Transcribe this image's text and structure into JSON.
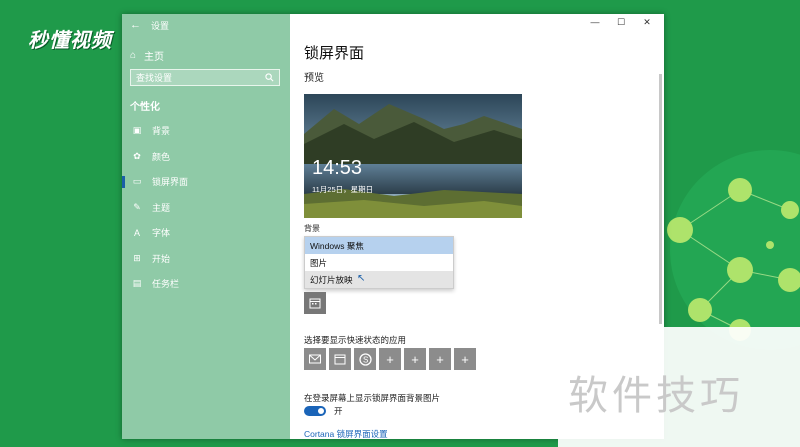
{
  "watermark_logo": "秒懂视频",
  "window": {
    "title": "设置",
    "controls": {
      "minimize": "—",
      "maximize": "☐",
      "close": "✕"
    }
  },
  "sidebar": {
    "home_label": "主页",
    "search_placeholder": "查找设置",
    "section_title": "个性化",
    "items": [
      {
        "label": "背景",
        "icon": "image-icon"
      },
      {
        "label": "颜色",
        "icon": "palette-icon"
      },
      {
        "label": "锁屏界面",
        "icon": "monitor-icon",
        "active": true
      },
      {
        "label": "主题",
        "icon": "brush-icon"
      },
      {
        "label": "字体",
        "icon": "font-icon"
      },
      {
        "label": "开始",
        "icon": "start-icon"
      },
      {
        "label": "任务栏",
        "icon": "taskbar-icon"
      }
    ]
  },
  "main": {
    "page_title": "锁屏界面",
    "preview_label": "预览",
    "preview_time": "14:53",
    "preview_date": "11月25日，星期日",
    "background_label": "背景",
    "dropdown_options": [
      {
        "label": "Windows 聚焦",
        "state": "selected"
      },
      {
        "label": "图片",
        "state": "normal"
      },
      {
        "label": "幻灯片放映",
        "state": "hover"
      }
    ],
    "quick_status_label": "选择要显示快速状态的应用",
    "quick_status_apps": [
      "mail-icon",
      "calendar-icon",
      "skype-icon",
      "+",
      "+",
      "+",
      "+"
    ],
    "show_bg_label": "在登录屏幕上显示锁屏界面背景图片",
    "toggle_state": "开",
    "cortana_link": "Cortana 锁屏界面设置"
  },
  "overlay_text": "软件技巧",
  "colors": {
    "desktop": "#1f9a4a",
    "sidebar": "#8fcaa7",
    "accent": "#1a64b8"
  }
}
